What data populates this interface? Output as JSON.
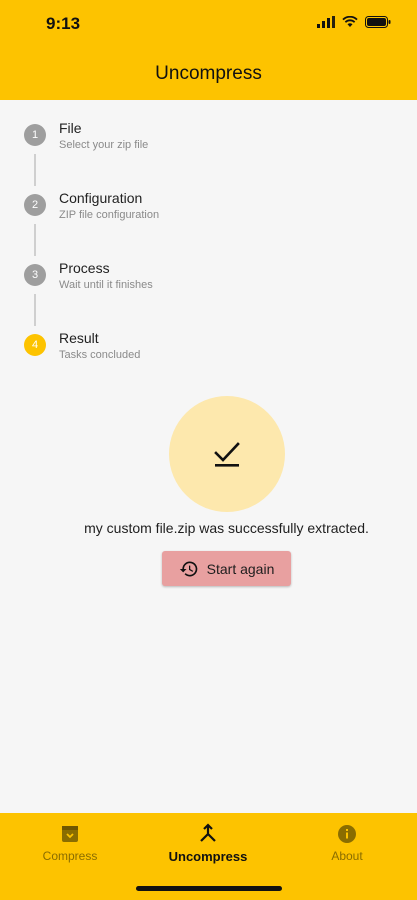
{
  "status_bar": {
    "time": "9:13"
  },
  "app_bar": {
    "title": "Uncompress"
  },
  "steps": [
    {
      "number": "1",
      "title": "File",
      "subtitle": "Select your zip file"
    },
    {
      "number": "2",
      "title": "Configuration",
      "subtitle": "ZIP file configuration"
    },
    {
      "number": "3",
      "title": "Process",
      "subtitle": "Wait until it finishes"
    },
    {
      "number": "4",
      "title": "Result",
      "subtitle": "Tasks concluded"
    }
  ],
  "result": {
    "message": "my custom file.zip was successfully extracted.",
    "start_again_label": "Start again"
  },
  "bottom_nav": {
    "items": [
      {
        "label": "Compress",
        "icon": "archive-icon"
      },
      {
        "label": "Uncompress",
        "icon": "uncompress-icon"
      },
      {
        "label": "About",
        "icon": "info-icon"
      }
    ],
    "active_index": 1
  },
  "colors": {
    "primary": "#fdc300",
    "step_inactive": "#9e9e9e",
    "result_circle": "#fde8ad",
    "start_button": "#e8a0a0"
  }
}
